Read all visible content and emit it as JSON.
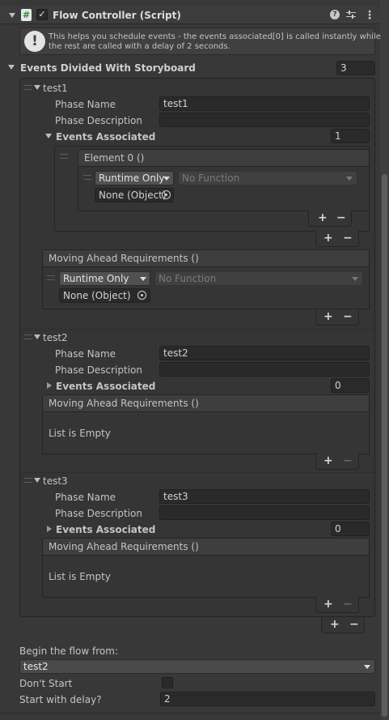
{
  "component": {
    "title": "Flow Controller (Script)",
    "enabled_check": "✓",
    "script_glyph": "#"
  },
  "help": {
    "text_line1": "This helps you schedule events - the events associated[0] is called instantly while",
    "text_line2": "the rest are called with a delay of 2 seconds."
  },
  "events": {
    "label": "Events Divided With Storyboard",
    "size": "3",
    "phases": [
      {
        "title": "test1",
        "phase_name_label": "Phase Name",
        "phase_name": "test1",
        "phase_description_label": "Phase Description",
        "phase_description": "",
        "events_associated_label": "Events Associated",
        "events_associated_size": "1",
        "element_header": "Element 0 ()",
        "runtime_mode": "Runtime Only",
        "function": "No Function",
        "object": "None (Object)",
        "moving_ahead_label": "Moving Ahead Requirements ()",
        "moving_runtime_mode": "Runtime Only",
        "moving_function": "No Function",
        "moving_object": "None (Object)"
      },
      {
        "title": "test2",
        "phase_name_label": "Phase Name",
        "phase_name": "test2",
        "phase_description_label": "Phase Description",
        "phase_description": "",
        "events_associated_label": "Events Associated",
        "events_associated_size": "0",
        "moving_ahead_label": "Moving Ahead Requirements ()",
        "empty_text": "List is Empty"
      },
      {
        "title": "test3",
        "phase_name_label": "Phase Name",
        "phase_name": "test3",
        "phase_description_label": "Phase Description",
        "phase_description": "",
        "events_associated_label": "Events Associated",
        "events_associated_size": "0",
        "moving_ahead_label": "Moving Ahead Requirements ()",
        "empty_text": "List is Empty"
      }
    ]
  },
  "footer": {
    "begin_label": "Begin the flow from:",
    "begin_value": "test2",
    "dont_start_label": "Don't Start",
    "delay_label": "Start with delay?",
    "delay_value": "2"
  },
  "controls": {
    "plus": "+",
    "minus": "−",
    "help_glyph": "?",
    "more_glyph": "⋮"
  },
  "colors": {
    "background": "#383838",
    "field": "#2a2a2a",
    "panel": "#353535",
    "accent_check": "#5cc36b"
  }
}
